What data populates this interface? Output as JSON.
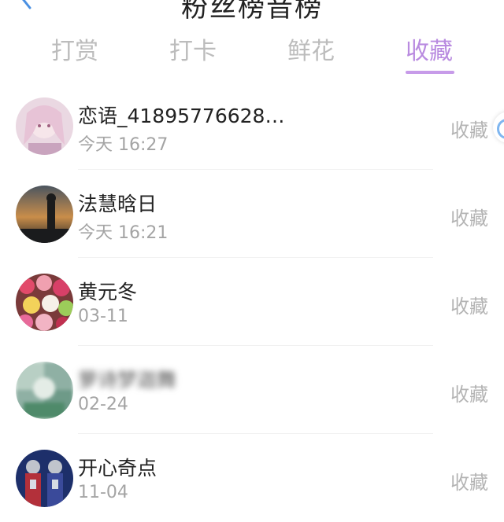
{
  "header": {
    "title": "粉丝榜音榜"
  },
  "tabs": [
    {
      "label": "打赏",
      "active": false
    },
    {
      "label": "打卡",
      "active": false
    },
    {
      "label": "鲜花",
      "active": false
    },
    {
      "label": "收藏",
      "active": true
    }
  ],
  "colors": {
    "accent": "#b98be0",
    "underline": "#c79be9",
    "muted": "#bcbcbc"
  },
  "list": [
    {
      "name": "恋语_41895776628…",
      "time": "今天 16:27",
      "action": "收藏",
      "avatar": "anime-girl-avatar"
    },
    {
      "name": "法慧晗日",
      "time": "今天 16:21",
      "action": "收藏",
      "avatar": "sunset-silhouette-avatar"
    },
    {
      "name": "黄元冬",
      "time": "03-11",
      "action": "收藏",
      "avatar": "flowers-avatar"
    },
    {
      "name": "萝诗梦迦舞",
      "time": "02-24",
      "action": "收藏",
      "avatar": "blurred-avatar"
    },
    {
      "name": "开心奇点",
      "time": "11-04",
      "action": "收藏",
      "avatar": "hero-figures-avatar"
    }
  ]
}
